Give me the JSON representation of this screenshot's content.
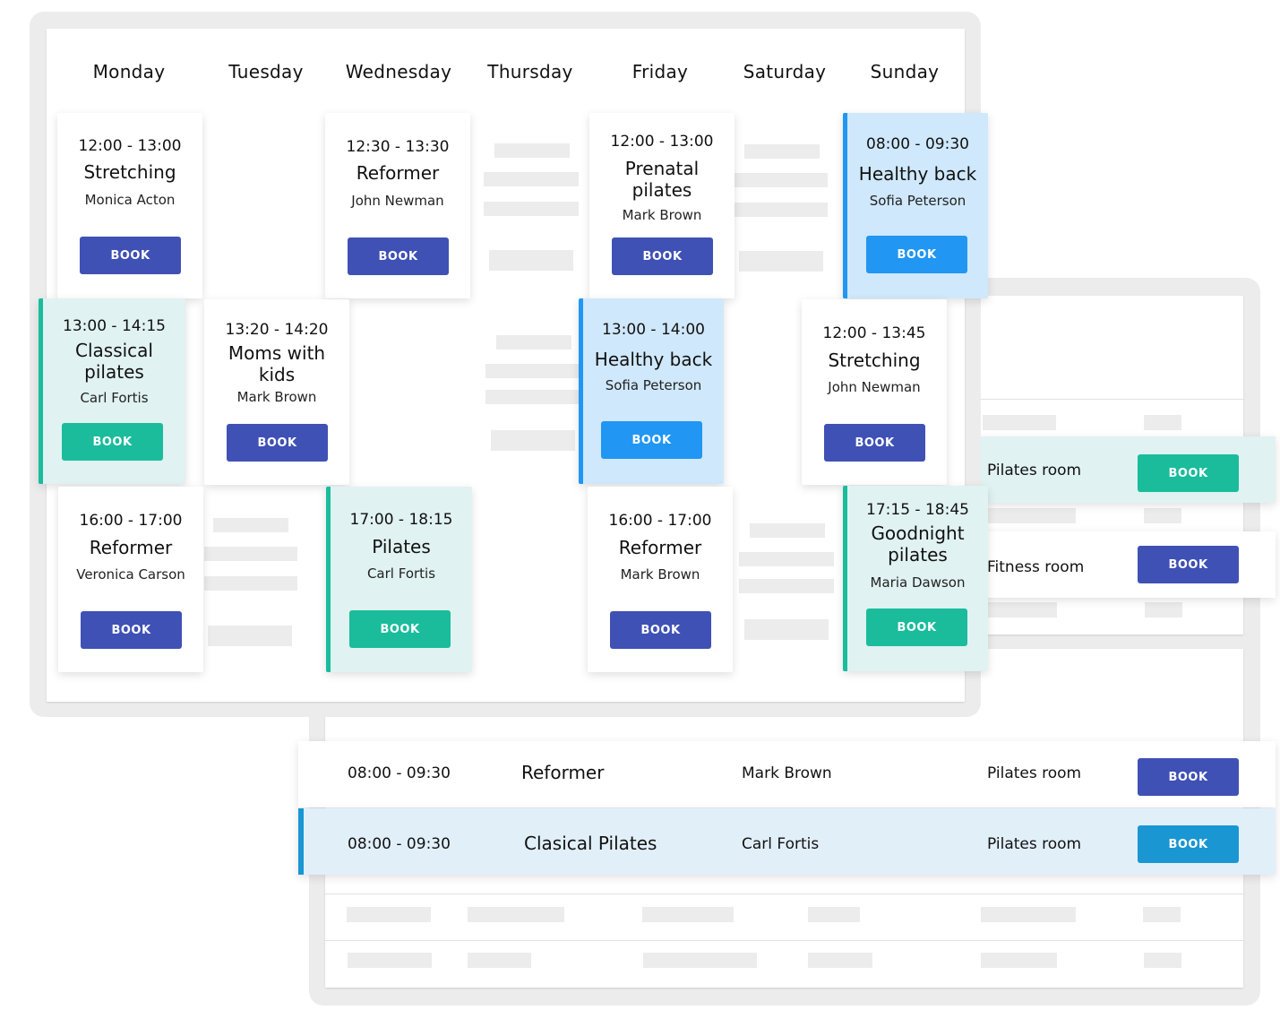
{
  "calendar": {
    "days": [
      "Monday",
      "Tuesday",
      "Wednesday",
      "Thursday",
      "Friday",
      "Saturday",
      "Sunday"
    ],
    "classes": [
      {
        "day": "Monday",
        "time": "12:00 - 13:00",
        "title": "Stretching",
        "instructor": "Monica Acton",
        "style": "default",
        "button": "BOOK"
      },
      {
        "day": "Wednesday",
        "time": "12:30 - 13:30",
        "title": "Reformer",
        "instructor": "John Newman",
        "style": "default",
        "button": "BOOK"
      },
      {
        "day": "Friday",
        "time": "12:00 - 13:00",
        "title": "Prenatal pilates",
        "instructor": "Mark Brown",
        "style": "default",
        "button": "BOOK"
      },
      {
        "day": "Sunday",
        "time": "08:00 - 09:30",
        "title": "Healthy back",
        "instructor": "Sofia Peterson",
        "style": "highlight-blue",
        "button": "BOOK"
      },
      {
        "day": "Monday",
        "time": "13:00 - 14:15",
        "title": "Classical pilates",
        "instructor": "Carl Fortis",
        "style": "highlight-teal",
        "button": "BOOK"
      },
      {
        "day": "Tuesday",
        "time": "13:20 - 14:20",
        "title": "Moms with kids",
        "instructor": "Mark Brown",
        "style": "default",
        "button": "BOOK"
      },
      {
        "day": "Friday",
        "time": "13:00 - 14:00",
        "title": "Healthy back",
        "instructor": "Sofia Peterson",
        "style": "highlight-blue",
        "button": "BOOK"
      },
      {
        "day": "Saturday",
        "time": "12:00 - 13:45",
        "title": "Stretching",
        "instructor": "John Newman",
        "style": "default",
        "button": "BOOK"
      },
      {
        "day": "Monday",
        "time": "16:00 - 17:00",
        "title": "Reformer",
        "instructor": "Veronica Carson",
        "style": "default",
        "button": "BOOK"
      },
      {
        "day": "Wednesday",
        "time": "17:00 - 18:15",
        "title": "Pilates",
        "instructor": "Carl Fortis",
        "style": "highlight-teal",
        "button": "BOOK"
      },
      {
        "day": "Friday",
        "time": "16:00 - 17:00",
        "title": "Reformer",
        "instructor": "Mark Brown",
        "style": "default",
        "button": "BOOK"
      },
      {
        "day": "Sunday",
        "time": "17:15 - 18:45",
        "title": "Goodnight pilates",
        "instructor": "Maria Dawson",
        "style": "highlight-teal",
        "button": "BOOK"
      }
    ]
  },
  "side_list": {
    "rows": [
      {
        "room": "Pilates room",
        "button": "BOOK",
        "style": "highlight-teal"
      },
      {
        "room": "Fitness room",
        "button": "BOOK",
        "style": "default"
      }
    ]
  },
  "bottom_list": {
    "rows": [
      {
        "time": "08:00 - 09:30",
        "title": "Reformer",
        "instructor": "Mark Brown",
        "room": "Pilates room",
        "button": "BOOK",
        "style": "default"
      },
      {
        "time": "08:00 - 09:30",
        "title": "Clasical Pilates",
        "instructor": "Carl Fortis",
        "room": "Pilates room",
        "button": "BOOK",
        "style": "highlight-blue"
      }
    ]
  },
  "colors": {
    "primary_indigo": "#3f51b5",
    "teal": "#1abc9c",
    "teal_bg": "#e0f2f1",
    "blue": "#2196f3",
    "blue_bg": "#cfe8fc",
    "row_blue": "#1a96d2",
    "row_blue_bg": "#e1eff9",
    "frame_gray": "#ececec",
    "placeholder_gray": "#ececec"
  }
}
